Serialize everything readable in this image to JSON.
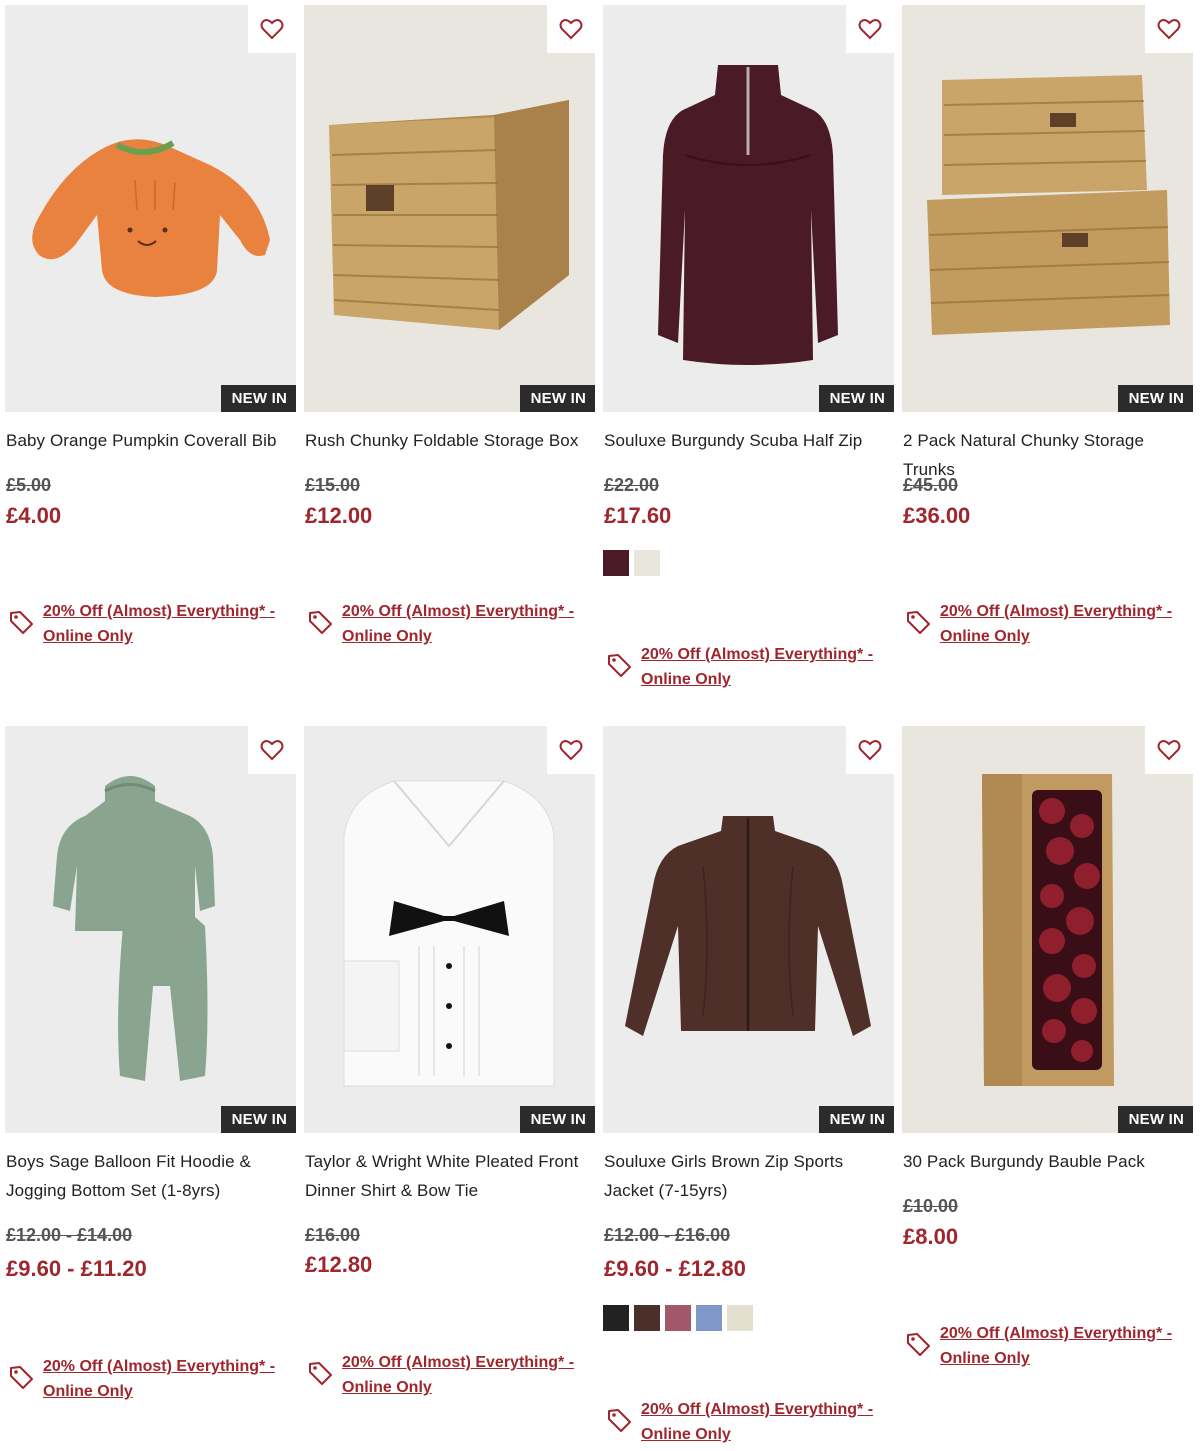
{
  "theme": {
    "accent": "#a0262e",
    "badge_bg": "#2b2b2b",
    "badge_text": "#ffffff"
  },
  "promo_text": "20% Off (Almost) Everything* - Online Only",
  "products": [
    {
      "name": "Baby Orange Pumpkin Coverall Bib",
      "badge": "NEW IN",
      "was": "£5.00",
      "now": "£4.00",
      "swatches": [],
      "image": "orange-pumpkin-bib"
    },
    {
      "name": "Rush Chunky Foldable Storage Box",
      "badge": "NEW IN",
      "was": "£15.00",
      "now": "£12.00",
      "swatches": [],
      "image": "wicker-storage-box"
    },
    {
      "name": "Souluxe Burgundy Scuba Half Zip",
      "badge": "NEW IN",
      "was": "£22.00",
      "now": "£17.60",
      "swatches": [
        "#4a1a26",
        "#e8e6dd"
      ],
      "image": "burgundy-half-zip"
    },
    {
      "name": "2 Pack Natural Chunky Storage Trunks",
      "badge": "NEW IN",
      "was": "£45.00",
      "now": "£36.00",
      "swatches": [],
      "image": "wicker-trunks"
    },
    {
      "name": "Boys Sage Balloon Fit Hoodie & Jogging Bottom Set (1-8yrs)",
      "badge": "NEW IN",
      "was": "£12.00 - £14.00",
      "now": "£9.60 - £11.20",
      "swatches": [],
      "image": "sage-hoodie-set"
    },
    {
      "name": "Taylor & Wright White Pleated Front Dinner Shirt & Bow Tie",
      "badge": "NEW IN",
      "was": "£16.00",
      "now": "£12.80",
      "swatches": [],
      "image": "white-dinner-shirt"
    },
    {
      "name": "Souluxe Girls Brown Zip Sports Jacket (7-15yrs)",
      "badge": "NEW IN",
      "was": "£12.00 - £16.00",
      "now": "£9.60 - £12.80",
      "swatches": [
        "#222222",
        "#4a3028",
        "#a3586a",
        "#7f97c9",
        "#e3e0cf"
      ],
      "image": "brown-zip-jacket"
    },
    {
      "name": "30 Pack Burgundy Bauble Pack",
      "badge": "NEW IN",
      "was": "£10.00",
      "now": "£8.00",
      "swatches": [],
      "image": "burgundy-baubles"
    }
  ]
}
